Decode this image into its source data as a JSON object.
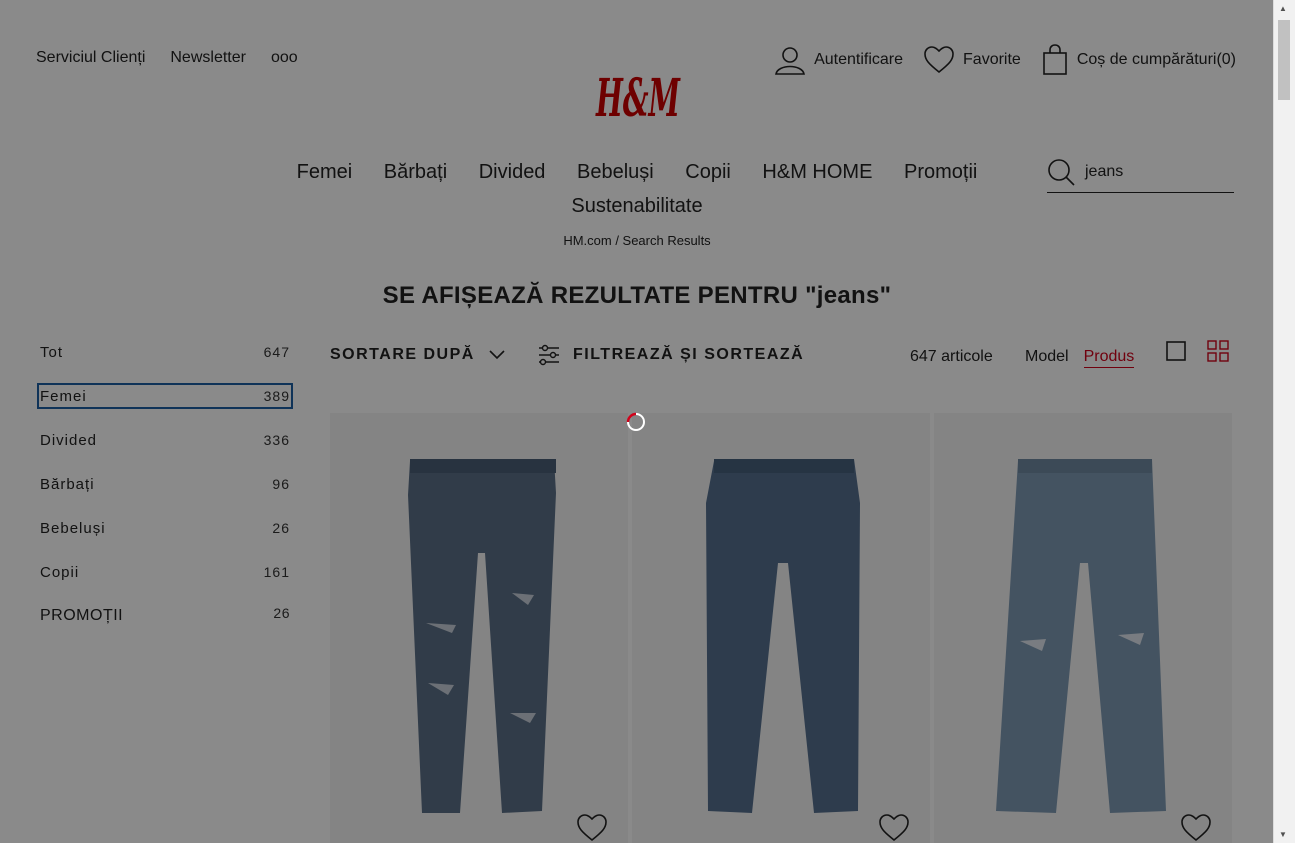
{
  "header": {
    "util_links": [
      "Serviciul Clienți",
      "Newsletter"
    ],
    "more_label": "ooo",
    "logo_text": "H&M",
    "account": {
      "login_label": "Autentificare",
      "favorites_label": "Favorite",
      "cart_label": "Coș de cumpărături(0)"
    }
  },
  "nav": {
    "items": [
      "Femei",
      "Bărbați",
      "Divided",
      "Bebeluși",
      "Copii",
      "H&M HOME",
      "Promoții",
      "Sustenabilitate"
    ]
  },
  "search": {
    "value": "jeans",
    "icon": "search-icon"
  },
  "breadcrumb": "HM.com / Search Results",
  "page_title": "SE AFIȘEAZĂ REZULTATE PENTRU \"jeans\"",
  "sidebar": {
    "items": [
      {
        "label": "Tot",
        "count": "647"
      },
      {
        "label": "Femei",
        "count": "389"
      },
      {
        "label": "Divided",
        "count": "336"
      },
      {
        "label": "Bărbați",
        "count": "96"
      },
      {
        "label": "Bebeluși",
        "count": "26"
      },
      {
        "label": "Copii",
        "count": "161"
      },
      {
        "label": "PROMOȚII",
        "count": "26"
      }
    ]
  },
  "toolbar": {
    "sort_label": "SORTARE DUPĂ",
    "filter_label": "FILTREAZĂ ȘI SORTEAZĂ",
    "total_label": "647 articole",
    "view_model": "Model",
    "view_product": "Produs",
    "active_view": "Produs"
  },
  "products": [
    {
      "name": "ripped-high-waist-jeans",
      "color": "#5b7088"
    },
    {
      "name": "mom-jeans",
      "color": "#55708f"
    },
    {
      "name": "wide-ripped-jeans",
      "color": "#7f9ab3"
    }
  ],
  "colors": {
    "accent": "#d0021b",
    "overlay": "rgba(0,0,0,0.46)"
  }
}
